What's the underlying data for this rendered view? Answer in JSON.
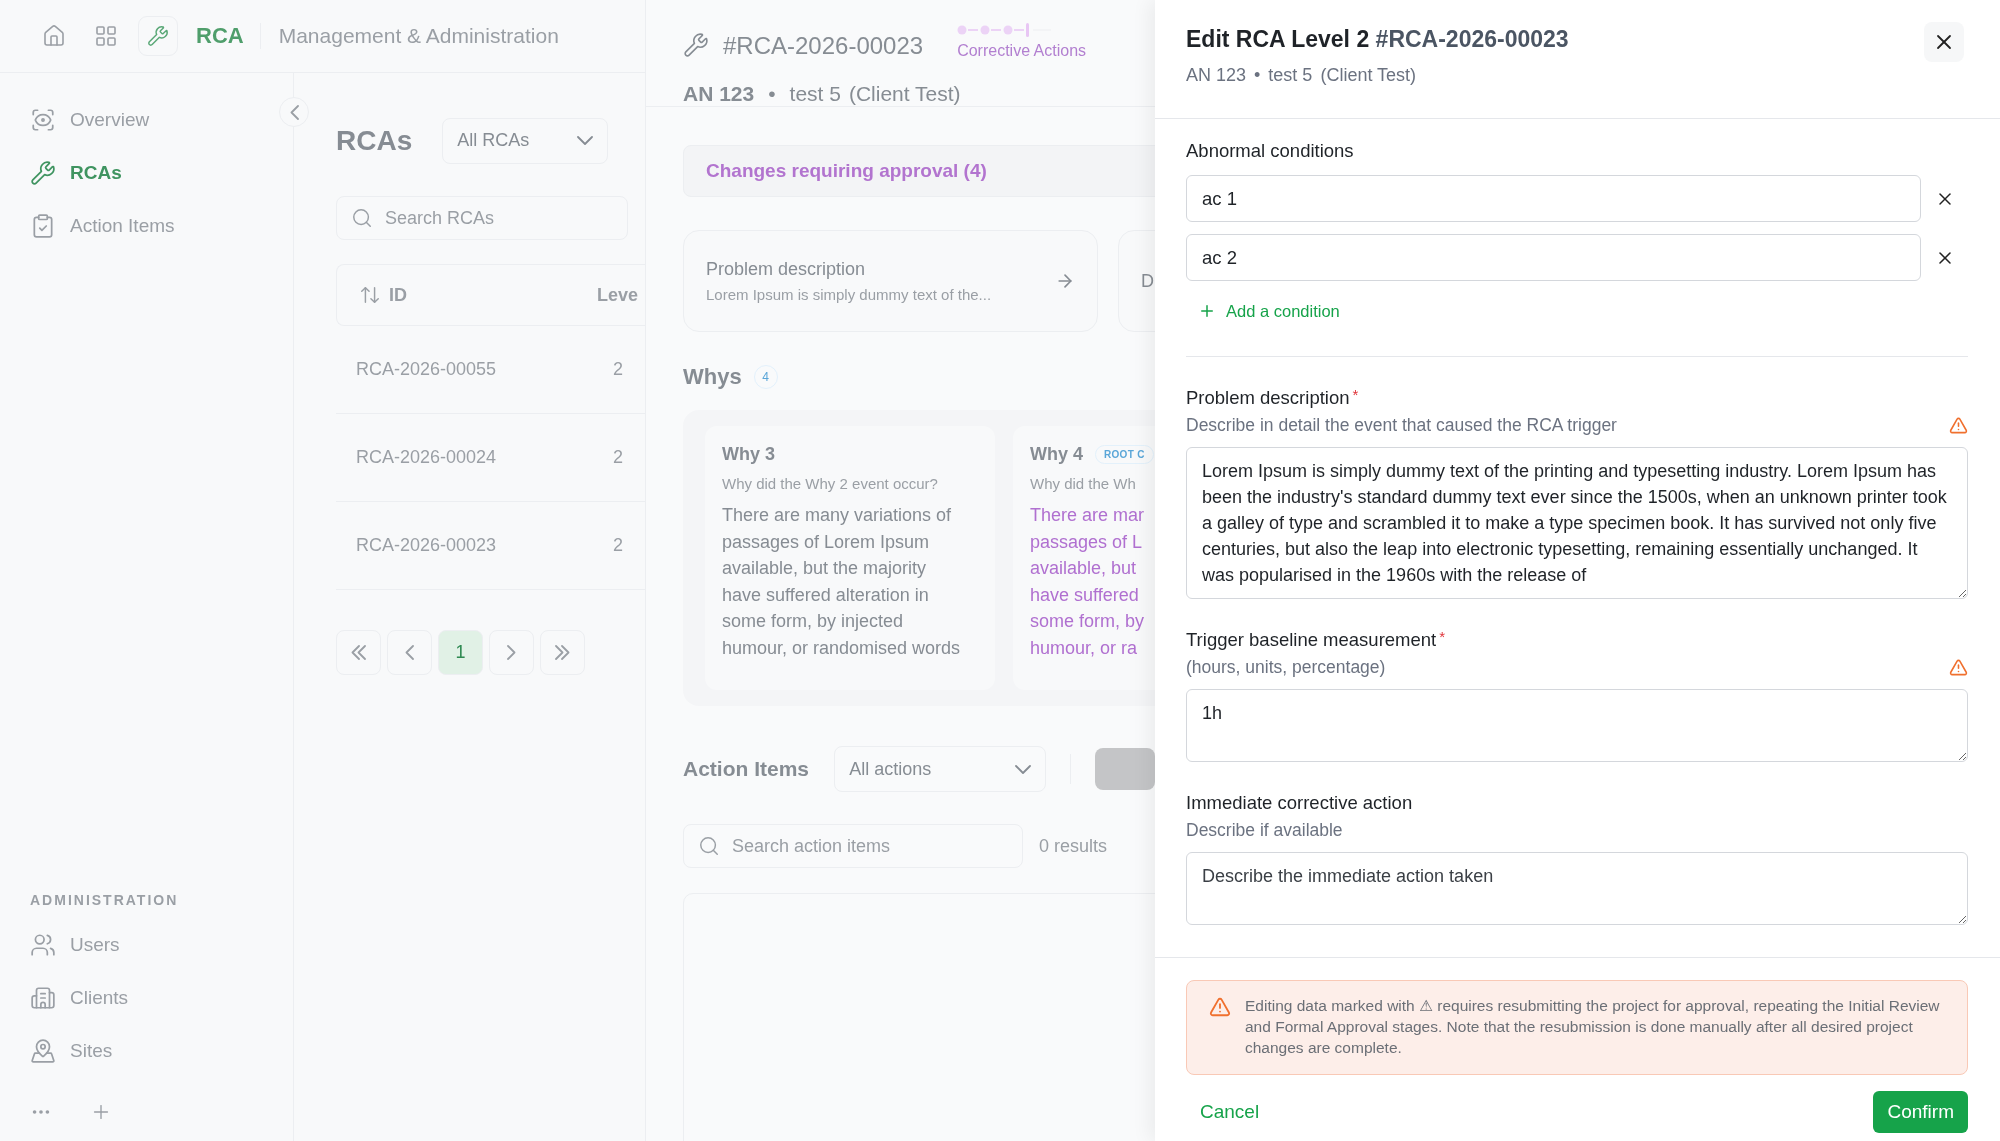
{
  "topbar": {
    "app_name": "RCA",
    "section": "Management & Administration"
  },
  "sidebar": {
    "items": [
      {
        "label": "Overview",
        "selected": false
      },
      {
        "label": "RCAs",
        "selected": true
      },
      {
        "label": "Action Items",
        "selected": false
      }
    ],
    "admin_heading": "ADMINISTRATION",
    "admin_items": [
      {
        "label": "Users"
      },
      {
        "label": "Clients"
      },
      {
        "label": "Sites"
      }
    ]
  },
  "rca_list": {
    "title": "RCAs",
    "filter": "All RCAs",
    "search_placeholder": "Search RCAs",
    "columns": [
      "ID",
      "Leve"
    ],
    "rows": [
      {
        "id": "RCA-2026-00055",
        "level": "2"
      },
      {
        "id": "RCA-2026-00024",
        "level": "2"
      },
      {
        "id": "RCA-2026-00023",
        "level": "2"
      }
    ],
    "pages": [
      {
        "label": "1",
        "selected": true
      }
    ]
  },
  "detail": {
    "id": "#RCA-2026-00023",
    "stage": "Corrective Actions",
    "meta": {
      "code": "AN 123",
      "separator": "•",
      "name": "test 5",
      "client": "(Client Test)"
    },
    "approval_banner": "Changes requiring approval (4)",
    "summary_cards": [
      {
        "title": "Problem description",
        "excerpt": "Lorem Ipsum is simply dummy text of the..."
      },
      {
        "title": "D"
      }
    ],
    "whys": {
      "title": "Whys",
      "count": "4",
      "cards": [
        {
          "title": "Why 3",
          "question": "Why did the Why 2 event occur?",
          "answer": "There are many variations of\npassages of Lorem Ipsum\navailable, but the majority\nhave suffered alteration in\nsome form, by injected\nhumour, or randomised words",
          "highlighted": false
        },
        {
          "title": "Why 4",
          "badge": "ROOT C",
          "question": "Why did the Wh",
          "answer": "There are mar\npassages of L\navailable, but\nhave suffered\nsome form, by\nhumour, or ra",
          "highlighted": true
        }
      ]
    },
    "actions": {
      "title": "Action Items",
      "filter": "All actions",
      "search_placeholder": "Search action items",
      "results": "0 results"
    }
  },
  "drawer": {
    "title": "Edit RCA Level 2",
    "title_id": "#RCA-2026-00023",
    "subtitle": {
      "code": "AN 123",
      "separator": "•",
      "name": "test 5",
      "client": "(Client Test)"
    },
    "conditions": {
      "label": "Abnormal conditions",
      "items": [
        "ac 1",
        "ac 2"
      ],
      "add_label": "Add a condition"
    },
    "fields": [
      {
        "kind": "long",
        "label": "Problem description",
        "required_mark": "*",
        "hint": "Describe in detail the event that caused the RCA trigger",
        "warning": true,
        "value": "Lorem Ipsum is simply dummy text of the printing and typesetting industry. Lorem Ipsum has been the industry's standard dummy text ever since the 1500s, when an unknown printer took a galley of type and scrambled it to make a type specimen book. It has survived not only five centuries, but also the leap into electronic typesetting, remaining essentially unchanged. It was popularised in the 1960s with the release of"
      },
      {
        "kind": "short",
        "label": "Trigger baseline measurement",
        "required_mark": "*",
        "hint": "(hours, units, percentage)",
        "warning": true,
        "value": "1h"
      },
      {
        "kind": "short",
        "label": "Immediate corrective action",
        "hint": "Describe if available",
        "warning": false,
        "placeholder": "Describe the immediate action taken"
      }
    ],
    "notice": "Editing data marked with ⚠ requires resubmitting the project for approval, repeating the Initial Review and Formal Approval stages. Note that the resubmission is done manually after all desired project changes are complete.",
    "cancel": "Cancel",
    "confirm": "Confirm"
  }
}
